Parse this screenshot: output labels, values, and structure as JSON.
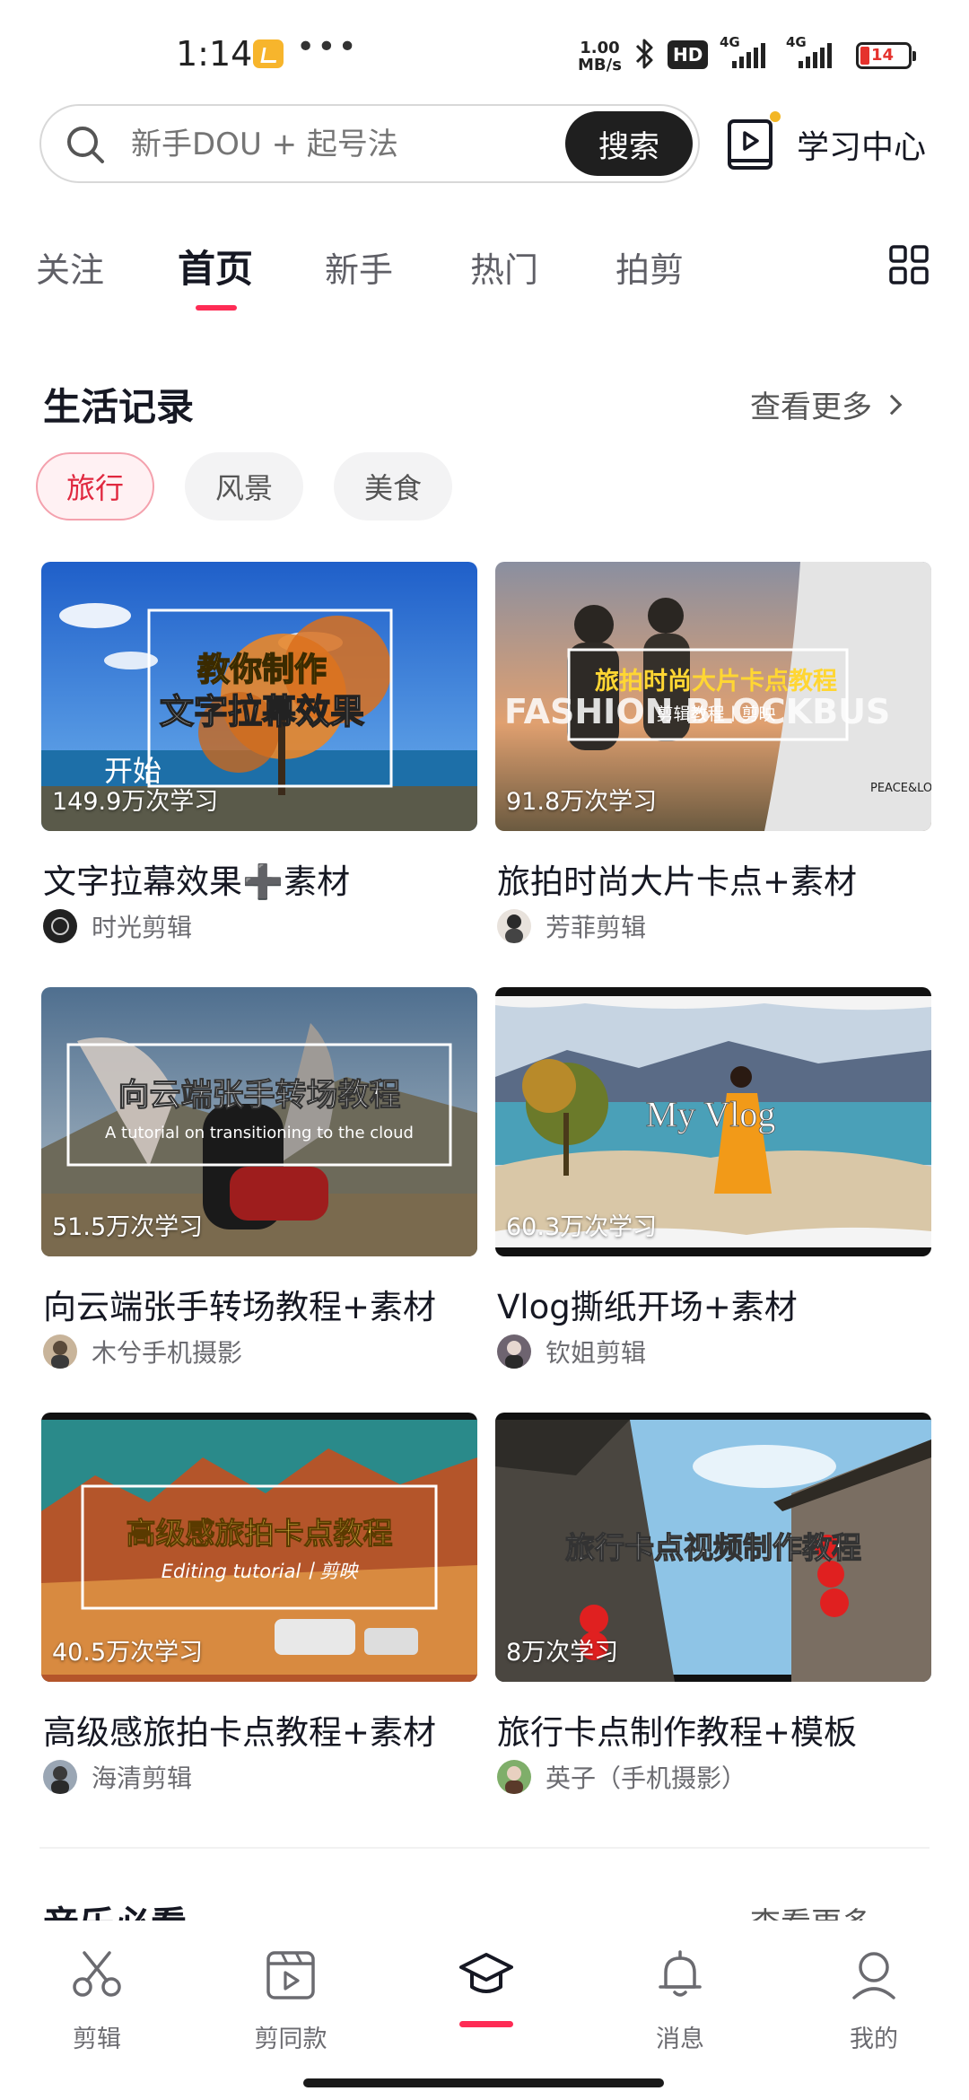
{
  "status_bar": {
    "time": "1:14",
    "speed_top": "1.00",
    "speed_bottom": "MB/s",
    "hd_label": "HD",
    "network_1": "4G",
    "network_2": "4G",
    "battery": "14"
  },
  "search": {
    "placeholder": "新手DOU + 起号法",
    "button_label": "搜索"
  },
  "learning_center": {
    "label": "学习中心"
  },
  "tabs": [
    {
      "label": "关注"
    },
    {
      "label": "首页"
    },
    {
      "label": "新手"
    },
    {
      "label": "热门"
    },
    {
      "label": "拍剪"
    }
  ],
  "section": {
    "title": "生活记录",
    "see_more": "查看更多",
    "chips": [
      {
        "label": "旅行"
      },
      {
        "label": "风景"
      },
      {
        "label": "美食"
      }
    ]
  },
  "cards": [
    {
      "title": "文字拉幕效果➕素材",
      "author": "时光剪辑",
      "views": "149.9万次学习",
      "thumb_text": "教你制作",
      "thumb_text2": "文字拉幕效果",
      "thumb_text3": "开始"
    },
    {
      "title": "旅拍时尚大片卡点+素材",
      "author": "芳菲剪辑",
      "views": "91.8万次学习",
      "thumb_text": "旅拍时尚大片卡点教程",
      "thumb_text2": "剪辑教程丨剪映",
      "thumb_text3": "FASHION BLOCKBUS",
      "thumb_text4": "PEACE&LO"
    },
    {
      "title": "向云端张手转场教程+素材",
      "author": "木兮手机摄影",
      "views": "51.5万次学习",
      "thumb_text": "向云端张手转场教程",
      "thumb_text2": "A tutorial on transitioning to the cloud"
    },
    {
      "title": "Vlog撕纸开场+素材",
      "author": "钦姐剪辑",
      "views": "60.3万次学习",
      "thumb_text": "My Vlog"
    },
    {
      "title": "高级感旅拍卡点教程+素材",
      "author": "海清剪辑",
      "views": "40.5万次学习",
      "thumb_text": "高级感旅拍卡点教程",
      "thumb_text2": "Editing tutorial丨剪映"
    },
    {
      "title": "旅行卡点制作教程+模板",
      "author": "英子（手机摄影）",
      "views": "8万次学习",
      "thumb_text": "旅行卡点视频制作教程"
    }
  ],
  "next_section": {
    "title": "音乐必看",
    "see_more": "查看更多"
  },
  "bottom_nav": [
    {
      "label": "剪辑",
      "icon": "scissors-icon"
    },
    {
      "label": "剪同款",
      "icon": "template-icon"
    },
    {
      "label": "",
      "icon": "graduation-cap-icon"
    },
    {
      "label": "消息",
      "icon": "bell-icon"
    },
    {
      "label": "我的",
      "icon": "profile-icon"
    }
  ],
  "colors": {
    "accent": "#fe2c55",
    "text": "#161823",
    "muted": "#6b6b70"
  }
}
